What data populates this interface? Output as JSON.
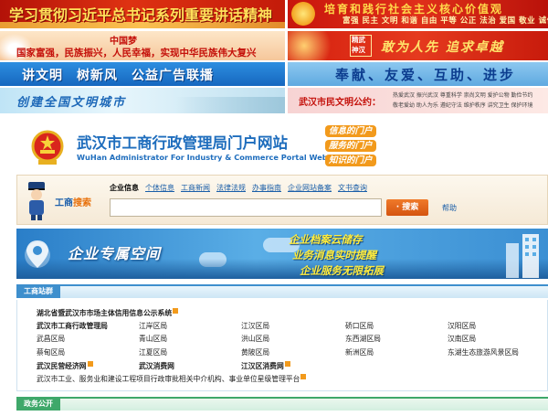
{
  "banners": {
    "b1": "学习贯彻习近平总书记系列重要讲话精神",
    "b2_main": "培育和践行社会主义核心价值观",
    "b2_sub": "富强 民主 文明 和谐 自由 平等 公正 法治 爱国 敬业 诚信 友善",
    "b3_line1": "中国梦",
    "b3_line2": "国家富强，民族振兴，人民幸福，实现中华民族伟大复兴",
    "b4_seal1": "精武",
    "b4_seal2": "神汉",
    "b4_main": "敢为人先 追求卓越",
    "b5": "讲文明　树新风　公益广告联播",
    "b6": "奉献、友爱、互助、进步",
    "b7": "创建全国文明城市",
    "b8_label": "武汉市民文明公约：",
    "b8_sub1": "热爱武汉 振兴武汉 尊重科学 崇尚文明 爱护公物 勤俭节约",
    "b8_sub2": "敬老爱幼 助人为乐 遵纪守法 维护秩序 讲究卫生 保护环境"
  },
  "header": {
    "title": "武汉市工商行政管理局门户网站",
    "subtitle": "WuHan Administrator For Industry & Commerce Portal Website",
    "gates": [
      "信息的门户",
      "服务的门户",
      "知识的门户"
    ]
  },
  "search": {
    "handle": "工商",
    "handle2": "搜索",
    "tabs": [
      "企业信息",
      "个体信息",
      "工商新闻",
      "法律法规",
      "办事指南",
      "企业网站备案",
      "文书查询"
    ],
    "active_tab": 0,
    "placeholder": "",
    "button": "· 搜索",
    "help": "帮助"
  },
  "enterprise": {
    "title": "企业专属空间",
    "lines": [
      "企业档案云储存",
      "业务消息实时提醒",
      "企业服务无限拓展"
    ]
  },
  "sites": {
    "section_title": "工商站群",
    "items": [
      {
        "label": "湖北省暨武汉市市场主体信用信息公示系统",
        "bold": true,
        "new": true
      },
      {
        "label": "武汉市工商行政管理局",
        "bold": true,
        "new": false
      },
      {
        "label": "江岸区局",
        "bold": false,
        "new": false
      },
      {
        "label": "江汉区局",
        "bold": false,
        "new": false
      },
      {
        "label": "硚口区局",
        "bold": false,
        "new": false
      },
      {
        "label": "汉阳区局",
        "bold": false,
        "new": false
      },
      {
        "label": "武昌区局",
        "bold": false,
        "new": false
      },
      {
        "label": "青山区局",
        "bold": false,
        "new": false
      },
      {
        "label": "洪山区局",
        "bold": false,
        "new": false
      },
      {
        "label": "东西湖区局",
        "bold": false,
        "new": false
      },
      {
        "label": "汉南区局",
        "bold": false,
        "new": false
      },
      {
        "label": "蔡甸区局",
        "bold": false,
        "new": false
      },
      {
        "label": "江夏区局",
        "bold": false,
        "new": false
      },
      {
        "label": "黄陂区局",
        "bold": false,
        "new": false
      },
      {
        "label": "新洲区局",
        "bold": false,
        "new": false
      },
      {
        "label": "东湖生态旅游风景区局",
        "bold": false,
        "new": false
      },
      {
        "label": "武汉民营经济网",
        "bold": true,
        "new": true
      },
      {
        "label": "武汉消费网",
        "bold": true,
        "new": false
      },
      {
        "label": "江汉区消费网",
        "bold": true,
        "new": true
      },
      {
        "label": "武汉市工业、服务业和建设工程项目行政审批相关中介机构、事业单位星级管理平台",
        "bold": false,
        "new": true
      }
    ]
  },
  "affairs": {
    "section_title": "政务公开"
  },
  "colors": {
    "accent_blue": "#1e6dbd",
    "orange": "#f29a1c",
    "section_blue": "#3e8fcd",
    "section_green": "#3fa86a"
  }
}
